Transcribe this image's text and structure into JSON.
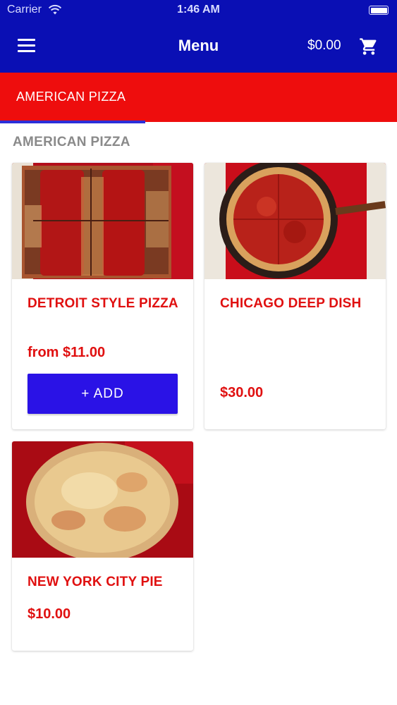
{
  "status_bar": {
    "carrier": "Carrier",
    "time": "1:46 AM"
  },
  "header": {
    "title": "Menu",
    "cart_total": "$0.00",
    "menu_icon": "hamburger-menu-icon",
    "cart_icon": "shopping-cart-icon",
    "background": "#0a0fb4"
  },
  "tabs": [
    {
      "label": "AMERICAN PIZZA",
      "active": true
    }
  ],
  "tab_bar_color": "#ee0d0d",
  "section": {
    "title": "AMERICAN PIZZA"
  },
  "products": [
    {
      "name": "DETROIT STYLE PIZZA",
      "price": "from $11.00",
      "button": "+ ADD"
    },
    {
      "name": "CHICAGO DEEP DISH",
      "price": "$30.00"
    },
    {
      "name": "NEW YORK CITY PIE",
      "price": "$10.00"
    }
  ],
  "colors": {
    "accent_red": "#e01010",
    "add_button": "#2a12e6"
  }
}
